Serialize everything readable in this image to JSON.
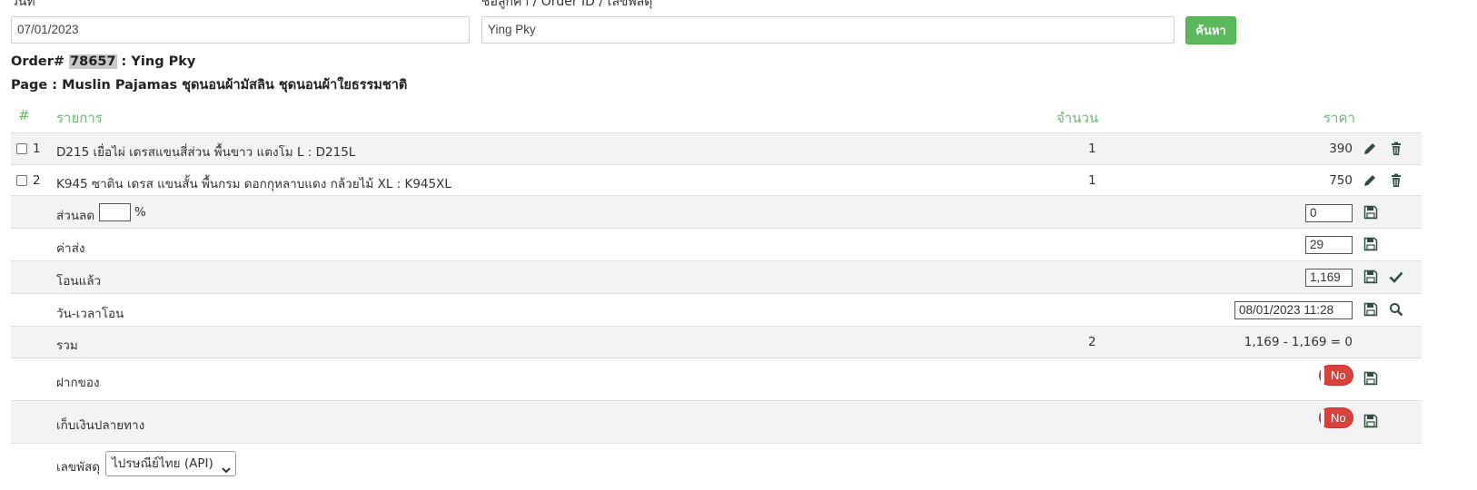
{
  "search": {
    "date_label": "วันที่",
    "date_value": "07/01/2023",
    "query_label": "ชื่อลูกค้า / Order ID / เลขพัสดุ",
    "query_value": "Ying Pky",
    "button_label": "ค้นหา"
  },
  "order": {
    "prefix": "Order# ",
    "id": "78657",
    "customer": " : Ying Pky",
    "page_line": "Page : Muslin Pajamas ชุดนอนผ้ามัสลิน ชุดนอนผ้าใยธรรมชาติ"
  },
  "table": {
    "headers": {
      "index": "#",
      "item": "รายการ",
      "qty": "จำนวน",
      "price": "ราคา"
    },
    "items": [
      {
        "no": "1",
        "name": "D215 เยื่อไผ่ เดรสแขนสี่ส่วน พื้นขาว แตงโม L : D215L",
        "qty": "1",
        "price": "390"
      },
      {
        "no": "2",
        "name": "K945 ซาติน เดรส แขนสั้น พื้นกรม ดอกกุหลาบแดง กล้วยไม้ XL : K945XL",
        "qty": "1",
        "price": "750"
      }
    ],
    "discount": {
      "label": "ส่วนลด",
      "percent_value": "",
      "percent_sign": "%",
      "value": "0"
    },
    "shipping": {
      "label": "ค่าส่ง",
      "value": "29"
    },
    "paid": {
      "label": "โอนแล้ว",
      "value": "1,169"
    },
    "transfer_time": {
      "label": "วัน-เวลาโอน",
      "value": "08/01/2023 11:28"
    },
    "total": {
      "label": "รวม",
      "qty": "2",
      "summary": "1,169 - 1,169 = 0"
    },
    "deposit": {
      "label": "ฝากของ",
      "toggle": "No"
    },
    "cod": {
      "label": "เก็บเงินปลายทาง",
      "toggle": "No"
    },
    "tracking": {
      "label": "เลขพัสดุ",
      "carrier_selected": "ไปรษณีย์ไทย (API)"
    }
  },
  "colors": {
    "accent_green": "#5cb85c",
    "header_green": "#6cba6c",
    "toggle_red": "#d9413a",
    "icon_dark": "#2f4f3f"
  }
}
